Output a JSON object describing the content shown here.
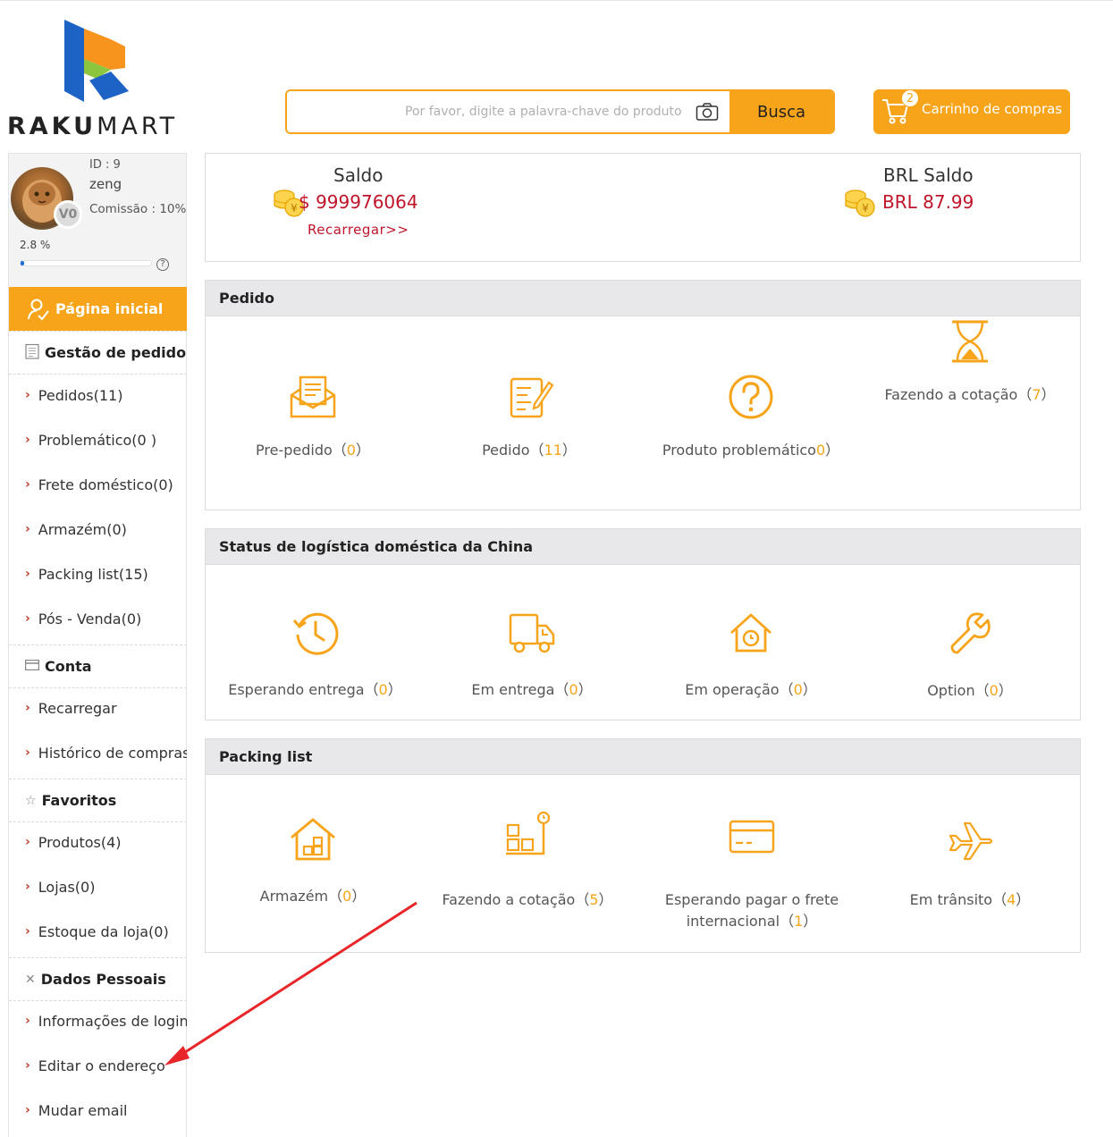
{
  "logo": {
    "text_bold": "RAKU",
    "text_rest": "MART"
  },
  "search": {
    "placeholder": "Por favor, digite a palavra-chave do produto",
    "button": "Busca",
    "camera_icon": "camera-icon"
  },
  "cart": {
    "count": "2",
    "label": "Carrinho de compras"
  },
  "profile": {
    "id": "ID : 9",
    "name": "zeng",
    "commission": "Comissão : 10%",
    "progress_text": "2.8 %",
    "progress": 0.028,
    "vip": "V0",
    "help": "?"
  },
  "sidebar": {
    "home": "Página inicial",
    "sections": [
      {
        "title": "Gestão de pedidos",
        "items": [
          "Pedidos(11)",
          "Problemático(0 )",
          "Frete doméstico(0)",
          "Armazém(0)",
          "Packing list(15)",
          "Pós - Venda(0)"
        ]
      },
      {
        "title": "Conta",
        "items": [
          "Recarregar",
          "Histórico de compras"
        ]
      },
      {
        "title": "Favoritos",
        "items": [
          "Produtos(4)",
          "Lojas(0)",
          "Estoque da loja(0)"
        ]
      },
      {
        "title": "Dados Pessoais",
        "items": [
          "Informações de login",
          "Editar o endereço",
          "Mudar email"
        ]
      }
    ]
  },
  "balance": {
    "saldo_title": "Saldo",
    "saldo_value": "$ 999976064",
    "recharge": "Recarregar>>",
    "brl_title": "BRL Saldo",
    "brl_value": "BRL 87.99"
  },
  "pedido": {
    "title": "Pedido",
    "items": [
      {
        "label": "Pre-pedido",
        "open": "（",
        "count": "0",
        "close": "）"
      },
      {
        "label": "Pedido",
        "open": "（",
        "count": "11",
        "close": "）"
      },
      {
        "label": "Produto problemático",
        "open": "",
        "count": "0",
        "close": "）"
      },
      {
        "label": "Fazendo a cotação",
        "open": "（",
        "count": "7",
        "close": "）"
      }
    ]
  },
  "logistica": {
    "title": "Status de logística doméstica da China",
    "items": [
      {
        "label": "Esperando entrega",
        "count": "0"
      },
      {
        "label": "Em entrega",
        "count": "0"
      },
      {
        "label": "Em operação",
        "count": "0"
      },
      {
        "label": "Option",
        "count": "0"
      }
    ]
  },
  "packing": {
    "title": "Packing list",
    "items": [
      {
        "label": "Armazém",
        "count": "0"
      },
      {
        "label": "Fazendo a cotação",
        "count": "5"
      },
      {
        "label1": "Esperando pagar o frete",
        "label2": "internacional",
        "count": "1"
      },
      {
        "label": "Em trânsito",
        "count": "4"
      }
    ]
  },
  "colors": {
    "accent": "#f7a41a",
    "money": "#c0142a",
    "header_bg": "#e8e8ea"
  }
}
